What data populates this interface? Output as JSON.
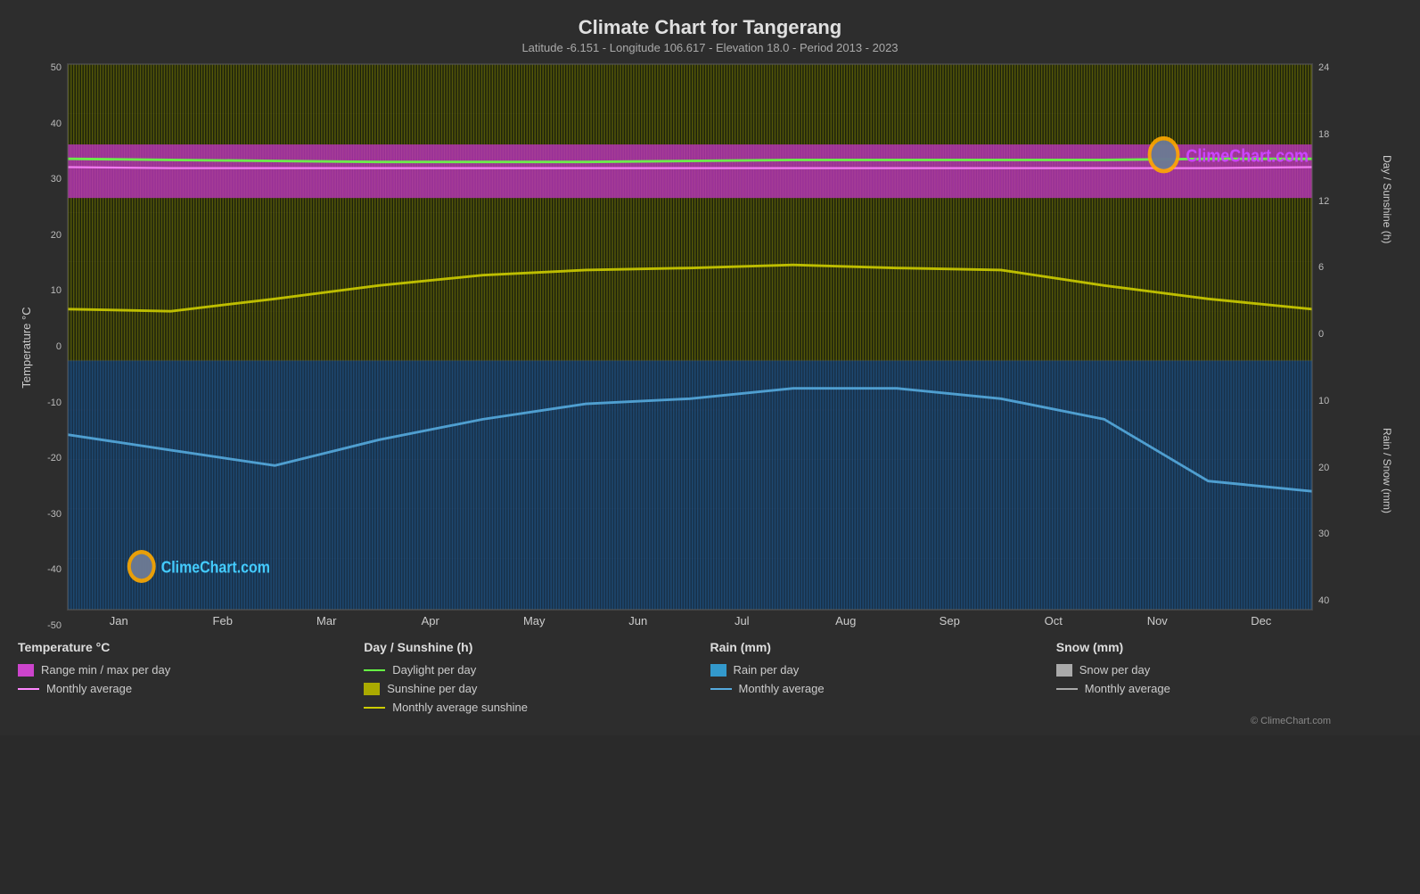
{
  "title": "Climate Chart for Tangerang",
  "subtitle": "Latitude -6.151 - Longitude 106.617 - Elevation 18.0 - Period 2013 - 2023",
  "logo_text": "ClimeChart.com",
  "copyright": "© ClimeChart.com",
  "left_axis": {
    "label": "Temperature °C",
    "ticks": [
      "50",
      "40",
      "30",
      "20",
      "10",
      "0",
      "-10",
      "-20",
      "-30",
      "-40",
      "-50"
    ]
  },
  "right_axis_sunshine": {
    "label": "Day / Sunshine (h)",
    "ticks": [
      "24",
      "18",
      "12",
      "6",
      "0"
    ]
  },
  "right_axis_rain": {
    "label": "Rain / Snow (mm)",
    "ticks": [
      "0",
      "10",
      "20",
      "30",
      "40"
    ]
  },
  "months": [
    "Jan",
    "Feb",
    "Mar",
    "Apr",
    "May",
    "Jun",
    "Jul",
    "Aug",
    "Sep",
    "Oct",
    "Nov",
    "Dec"
  ],
  "legend": {
    "temperature": {
      "title": "Temperature °C",
      "items": [
        {
          "type": "box",
          "color": "#cc44cc",
          "text": "Range min / max per day"
        },
        {
          "type": "line",
          "color": "#cc44cc",
          "text": "Monthly average"
        }
      ]
    },
    "sunshine": {
      "title": "Day / Sunshine (h)",
      "items": [
        {
          "type": "line",
          "color": "#88ee44",
          "text": "Daylight per day"
        },
        {
          "type": "box",
          "color": "#aaaa00",
          "text": "Sunshine per day"
        },
        {
          "type": "line",
          "color": "#cccc00",
          "text": "Monthly average sunshine"
        }
      ]
    },
    "rain": {
      "title": "Rain (mm)",
      "items": [
        {
          "type": "box",
          "color": "#3399cc",
          "text": "Rain per day"
        },
        {
          "type": "line",
          "color": "#4499cc",
          "text": "Monthly average"
        }
      ]
    },
    "snow": {
      "title": "Snow (mm)",
      "items": [
        {
          "type": "box",
          "color": "#aaaaaa",
          "text": "Snow per day"
        },
        {
          "type": "line",
          "color": "#aaaaaa",
          "text": "Monthly average"
        }
      ]
    }
  }
}
